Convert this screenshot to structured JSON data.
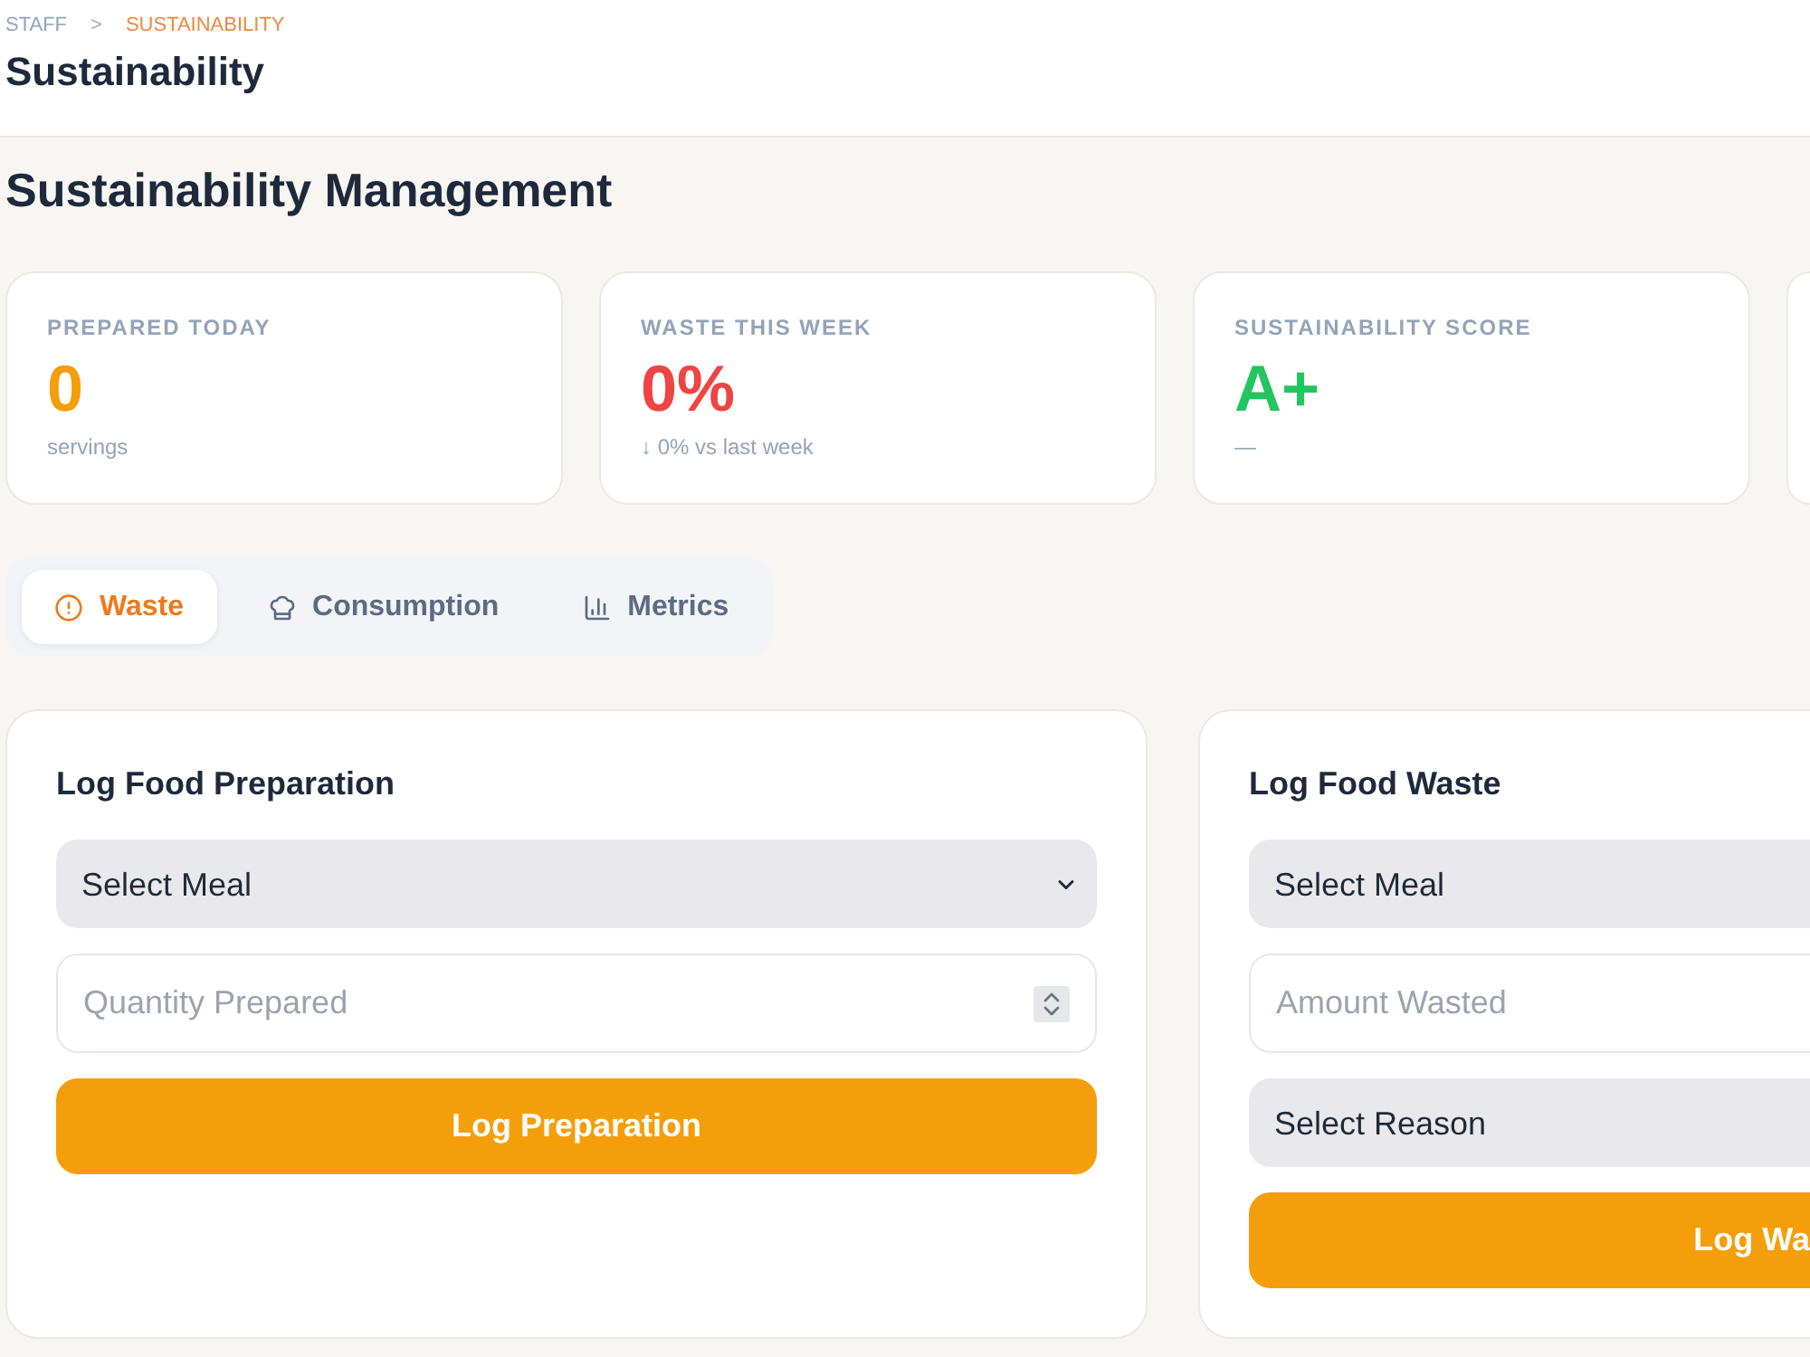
{
  "breadcrumb": {
    "separator": ">",
    "items": [
      {
        "label": "STAFF",
        "selected": false
      },
      {
        "label": "SUSTAINABILITY",
        "selected": true
      }
    ]
  },
  "header": {
    "title": "Sustainability"
  },
  "page_title": "Sustainability Management",
  "stats": [
    {
      "label": "PREPARED TODAY",
      "value": "0",
      "note": "servings",
      "color": "#f59e0b"
    },
    {
      "label": "WASTE THIS WEEK",
      "value": "0%",
      "note": "↓ 0% vs last week",
      "color": "#ef4444"
    },
    {
      "label": "SUSTAINABILITY SCORE",
      "value": "A+",
      "note": "—",
      "color": "#22c55e"
    }
  ],
  "tabs": [
    {
      "label": "Waste",
      "selected": true
    },
    {
      "label": "Consumption",
      "selected": false
    },
    {
      "label": "Metrics",
      "selected": false
    }
  ],
  "forms": [
    {
      "title": "Log Food Preparation",
      "fields": [
        {
          "kind": "select",
          "value": "Select Meal"
        },
        {
          "kind": "number",
          "placeholder": "Quantity Prepared"
        }
      ],
      "button": "Log Preparation"
    },
    {
      "title": "Log Food Waste",
      "fields": [
        {
          "kind": "select",
          "value": "Select Meal"
        },
        {
          "kind": "number",
          "placeholder": "Amount Wasted"
        },
        {
          "kind": "select",
          "value": "Select Reason"
        }
      ],
      "button": "Log Wa"
    }
  ]
}
